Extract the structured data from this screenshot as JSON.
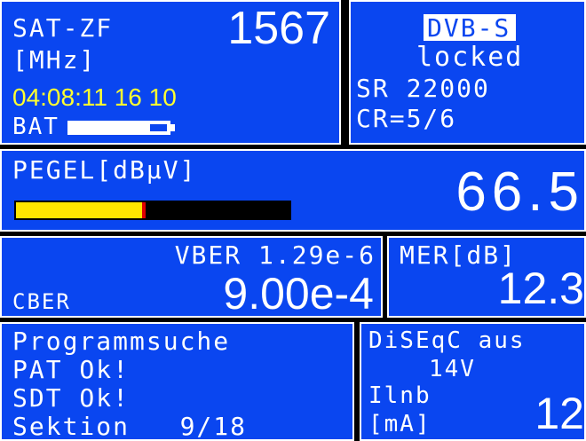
{
  "sat_if": {
    "label": "SAT-ZF",
    "unit": "[MHz]",
    "frequency": "1567",
    "datetime": "04:08:11 16 10",
    "battery_label": "BAT",
    "battery_level": 0.8
  },
  "dvb": {
    "standard": "DVB-S",
    "lock_status": "locked",
    "symbol_rate": "SR 22000",
    "code_rate": "CR=5/6"
  },
  "level": {
    "label": "PEGEL[dBµV]",
    "value": "66.5",
    "bar_fill": 0.46,
    "colors": {
      "bar": "#ffe600",
      "marker": "#e00000"
    }
  },
  "ber": {
    "vber": "VBER 1.29e-6",
    "cber_label": "CBER",
    "cber_value": "9.00e-4"
  },
  "mer": {
    "label": "MER[dB]",
    "value": "12.3"
  },
  "search": {
    "title": "Programmsuche",
    "pat": "PAT Ok!",
    "sdt": "SDT Ok!",
    "section": "Sektion   9/18"
  },
  "lnb": {
    "diseqc": "DiSEqC aus",
    "voltage": "14V",
    "current_label": "Ilnb",
    "current_unit": "[mA]",
    "current_value": "12"
  },
  "colors": {
    "panel_bg": "#0a46f0",
    "border": "#ffffff",
    "highlight_text": "#ffff30"
  }
}
